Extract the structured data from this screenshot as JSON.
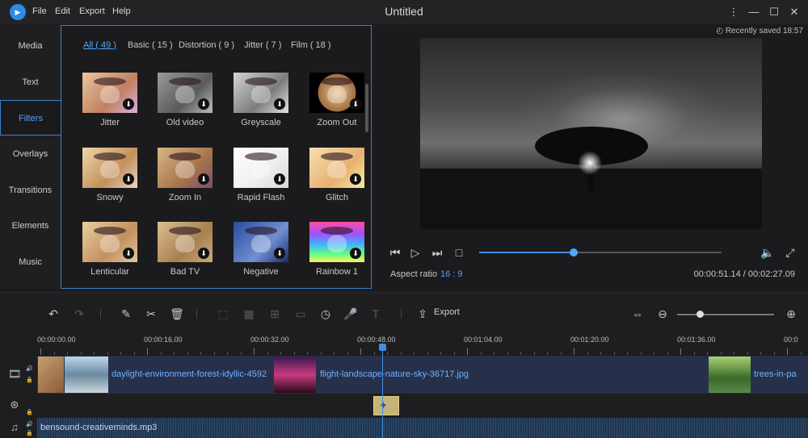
{
  "titlebar": {
    "title": "Untitled",
    "logo_text": "▶",
    "menu": [
      "File",
      "Edit",
      "Export",
      "Help"
    ]
  },
  "left_nav": {
    "items": [
      "Media",
      "Text",
      "Filters",
      "Overlays",
      "Transitions",
      "Elements",
      "Music"
    ],
    "active": "Filters"
  },
  "filter_panel": {
    "tabs": [
      "All ( 49 )",
      "Basic ( 15 )",
      "Distortion ( 9 )",
      "Jitter ( 7 )",
      "Film ( 18 )"
    ],
    "active_tab": "All ( 49 )",
    "filters": [
      {
        "label": "Jitter",
        "tone": "linear-gradient(135deg,#e9c6a0,#c08060 60%,#d8b0e0)"
      },
      {
        "label": "Old video",
        "tone": "linear-gradient(135deg,#9a9a9a,#5a5a5a 60%,#bdbdbd)"
      },
      {
        "label": "Greyscale",
        "tone": "linear-gradient(135deg,#d4d4d4,#7c7c7c 60%,#e6e6e6)"
      },
      {
        "label": "Zoom Out",
        "tone": "radial-gradient(circle,#e8c490 0%,#a06d40 55%,#000 56%)"
      },
      {
        "label": "Snowy",
        "tone": "linear-gradient(135deg,#f0d7a8,#c38f5c 60%,#e9d7c0)"
      },
      {
        "label": "Zoom In",
        "tone": "linear-gradient(135deg,#d9b688,#a87448 60%,#7a5070)"
      },
      {
        "label": "Rapid Flash",
        "tone": "linear-gradient(135deg,#ffffff,#eeeeee 60%,#d8d8d8)"
      },
      {
        "label": "Glitch",
        "tone": "linear-gradient(135deg,#f5e0b0,#e8b070 60%,#f0f0a0)"
      },
      {
        "label": "Lenticular",
        "tone": "linear-gradient(135deg,#e8d0a0,#c49060 60%,#e0c8a0)"
      },
      {
        "label": "Bad TV",
        "tone": "linear-gradient(135deg,#dcc090,#a88050 60%,#c8a878)"
      },
      {
        "label": "Negative",
        "tone": "linear-gradient(135deg,#2a4aa0,#7090d0 60%,#1a2a70)"
      },
      {
        "label": "Rainbow 1",
        "tone": "linear-gradient(180deg,#ff4fa0,#a050ff 30%,#40b0ff 55%,#60ff80 80%,#fff060)"
      }
    ],
    "download_icon": "download-icon"
  },
  "preview": {
    "saved_status": "Recently saved 18:57",
    "aspect_label": "Aspect ratio",
    "aspect_value": "16 : 9",
    "time_readout": "00:00:51.14 / 00:02:27.09",
    "progress_fraction": 0.39
  },
  "toolbar": {
    "export_label": "Export",
    "zoom_fraction": 0.23
  },
  "ruler": {
    "labels": [
      "00:00:00.00",
      "00:00:16.00",
      "00:00:32.00",
      "00:00:48.00",
      "00:01:04.00",
      "00:01:20.00",
      "00:01:36.00",
      "00:0"
    ]
  },
  "timeline": {
    "video_clips": [
      {
        "name": "daylight-environment-forest-idyllic-4592"
      },
      {
        "name": "flight-landscape-nature-sky-36717.jpg"
      },
      {
        "name": "trees-in-pa"
      }
    ],
    "audio_clip": "bensound-creativeminds.mp3"
  },
  "colors": {
    "accent": "#3d8fe0",
    "video_track": "#26304a",
    "audio_track": "#1f3550",
    "effect_chip": "#c7b377"
  }
}
